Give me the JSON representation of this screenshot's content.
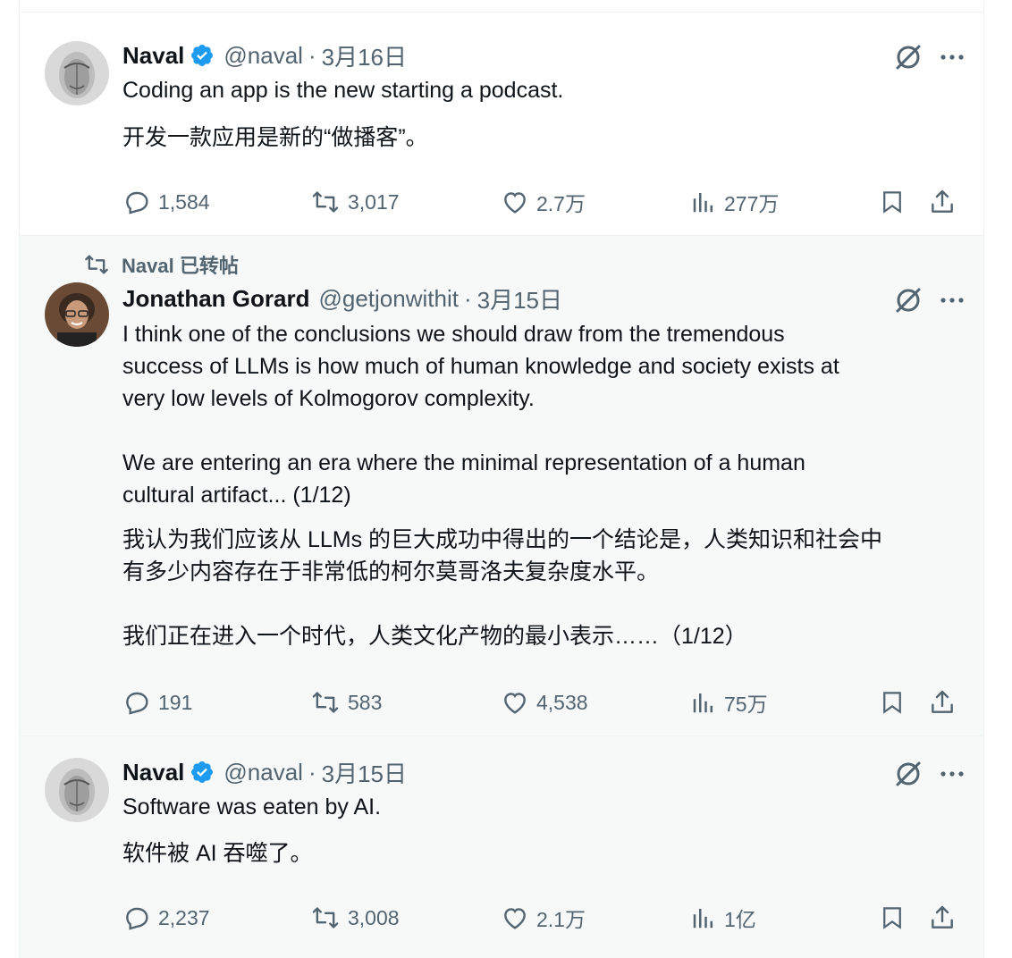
{
  "tweets": [
    {
      "display_name": "Naval",
      "handle": "@naval",
      "dot": "·",
      "date": "3月16日",
      "text": [
        "Coding an app is the new starting a podcast."
      ],
      "translation": [
        "开发一款应用是新的“做播客”。"
      ],
      "replies": "1,584",
      "retweets": "3,017",
      "likes": "2.7万",
      "views": "277万"
    },
    {
      "retweet_context": "Naval 已转帖",
      "display_name": "Jonathan Gorard",
      "handle": "@getjonwithit",
      "dot": "·",
      "date": "3月15日",
      "text": [
        "I think one of the conclusions we should draw from the tremendous",
        "success of LLMs is how much of human knowledge and society exists at",
        "very low levels of Kolmogorov complexity.",
        "",
        "We are entering an era where the minimal representation of a human",
        "cultural artifact... (1/12)"
      ],
      "translation": [
        "我认为我们应该从 LLMs 的巨大成功中得出的一个结论是，人类知识和社会中",
        "有多少内容存在于非常低的柯尔莫哥洛夫复杂度水平。",
        "",
        "我们正在进入一个时代，人类文化产物的最小表示……（1/12）"
      ],
      "replies": "191",
      "retweets": "583",
      "likes": "4,538",
      "views": "75万"
    },
    {
      "display_name": "Naval",
      "handle": "@naval",
      "dot": "·",
      "date": "3月15日",
      "text": [
        "Software was eaten by AI."
      ],
      "translation": [
        "软件被 AI 吞噬了。"
      ],
      "replies": "2,237",
      "retweets": "3,008",
      "likes": "2.1万",
      "views": "1亿"
    }
  ],
  "colors": {
    "text_primary": "#0f1419",
    "text_secondary": "#536471",
    "verified_blue": "#1d9bf0",
    "border": "#eff3f4",
    "hover_bg": "#f7f9f9"
  },
  "icons": [
    "verified-badge-icon",
    "grok-icon",
    "more-icon",
    "reply-icon",
    "retweet-icon",
    "like-icon",
    "views-icon",
    "bookmark-icon",
    "share-icon"
  ]
}
